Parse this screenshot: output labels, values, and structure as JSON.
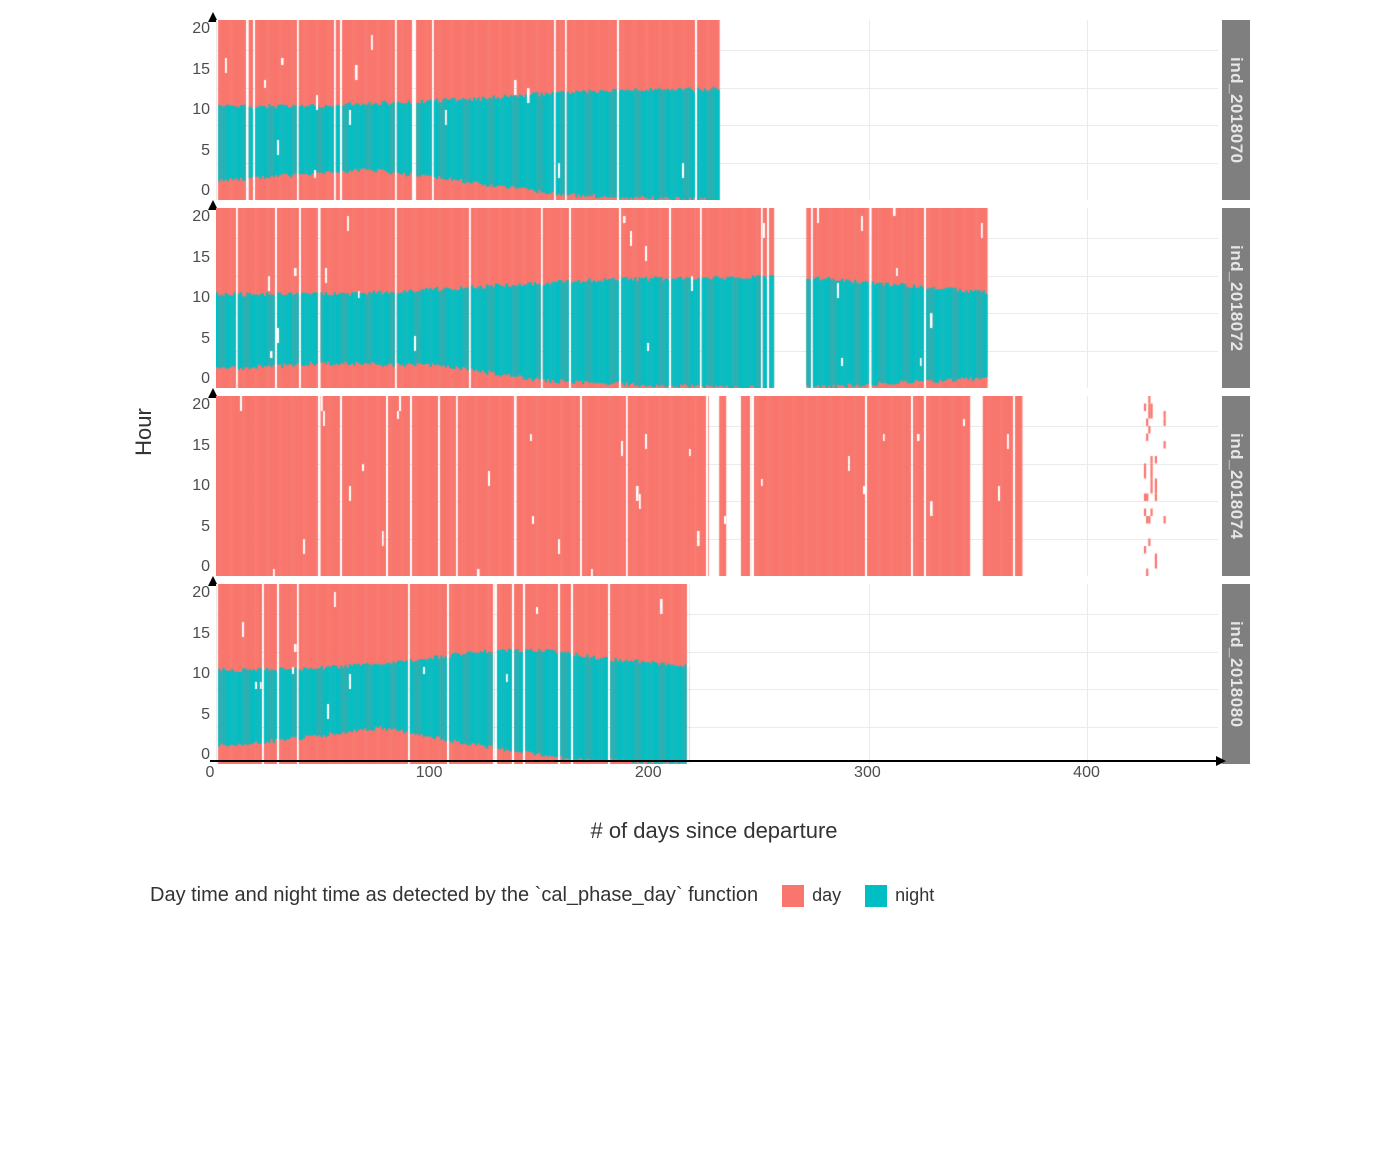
{
  "chart_data": {
    "type": "heatmap",
    "xlabel": "# of days since departure",
    "ylabel": "Hour",
    "legend_title": "Day time and night time as detected by the `cal_phase_day` function",
    "legend_items": [
      {
        "name": "day",
        "color": "#F8766D"
      },
      {
        "name": "night",
        "color": "#00BFC4"
      }
    ],
    "x_ticks": [
      0,
      100,
      200,
      300,
      400
    ],
    "y_ticks": [
      0,
      5,
      10,
      15,
      20
    ],
    "xlim": [
      0,
      460
    ],
    "ylim": [
      0,
      24
    ],
    "facets": [
      {
        "label": "ind_2018070",
        "data_range": [
          0,
          230
        ],
        "gaps": [],
        "night_band_present": true,
        "night_lower": [
          {
            "x": 0,
            "h": 2.5
          },
          {
            "x": 30,
            "h": 3.2
          },
          {
            "x": 70,
            "h": 4.0
          },
          {
            "x": 100,
            "h": 3.0
          },
          {
            "x": 130,
            "h": 1.8
          },
          {
            "x": 160,
            "h": 0.7
          },
          {
            "x": 190,
            "h": 0.3
          },
          {
            "x": 230,
            "h": 0.0
          }
        ],
        "night_upper": [
          {
            "x": 0,
            "h": 12.5
          },
          {
            "x": 40,
            "h": 12.5
          },
          {
            "x": 80,
            "h": 13.0
          },
          {
            "x": 120,
            "h": 13.5
          },
          {
            "x": 160,
            "h": 14.4
          },
          {
            "x": 200,
            "h": 14.7
          },
          {
            "x": 230,
            "h": 14.8
          }
        ]
      },
      {
        "label": "ind_2018072",
        "data_range": [
          0,
          353
        ],
        "gaps": [
          [
            256,
            270
          ]
        ],
        "night_band_present": true,
        "night_lower": [
          {
            "x": 0,
            "h": 2.5
          },
          {
            "x": 50,
            "h": 3.3
          },
          {
            "x": 100,
            "h": 3.0
          },
          {
            "x": 150,
            "h": 1.0
          },
          {
            "x": 200,
            "h": 0.3
          },
          {
            "x": 256,
            "h": 0.0
          },
          {
            "x": 270,
            "h": 0.0
          },
          {
            "x": 310,
            "h": 0.7
          },
          {
            "x": 353,
            "h": 1.3
          }
        ],
        "night_upper": [
          {
            "x": 0,
            "h": 12.5
          },
          {
            "x": 60,
            "h": 12.5
          },
          {
            "x": 120,
            "h": 13.5
          },
          {
            "x": 180,
            "h": 14.5
          },
          {
            "x": 256,
            "h": 14.8
          },
          {
            "x": 270,
            "h": 14.8
          },
          {
            "x": 310,
            "h": 13.8
          },
          {
            "x": 353,
            "h": 12.8
          }
        ]
      },
      {
        "label": "ind_2018074",
        "data_range": [
          0,
          448
        ],
        "gaps": [
          [
            226,
            230
          ],
          [
            234,
            240
          ],
          [
            346,
            351
          ],
          [
            370,
            425
          ],
          [
            438,
            440
          ]
        ],
        "night_band_present": false,
        "sparse_after": 425
      },
      {
        "label": "ind_2018080",
        "data_range": [
          0,
          216
        ],
        "gaps": [],
        "night_band_present": true,
        "night_lower": [
          {
            "x": 0,
            "h": 2.4
          },
          {
            "x": 40,
            "h": 3.5
          },
          {
            "x": 75,
            "h": 4.8
          },
          {
            "x": 100,
            "h": 3.5
          },
          {
            "x": 130,
            "h": 2.0
          },
          {
            "x": 160,
            "h": 0.7
          },
          {
            "x": 200,
            "h": 0.2
          },
          {
            "x": 216,
            "h": 0.0
          }
        ],
        "night_upper": [
          {
            "x": 0,
            "h": 12.5
          },
          {
            "x": 40,
            "h": 12.7
          },
          {
            "x": 80,
            "h": 13.4
          },
          {
            "x": 120,
            "h": 15.0
          },
          {
            "x": 150,
            "h": 15.2
          },
          {
            "x": 180,
            "h": 14.0
          },
          {
            "x": 216,
            "h": 13.0
          }
        ]
      }
    ]
  }
}
